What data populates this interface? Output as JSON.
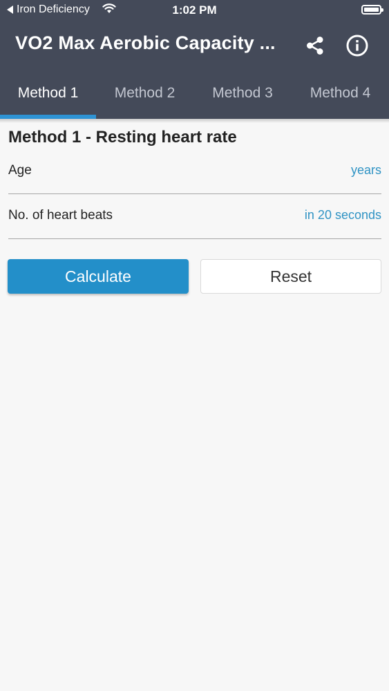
{
  "status_bar": {
    "back_label": "Iron Deficiency",
    "time": "1:02 PM"
  },
  "header": {
    "title": "VO2 Max Aerobic Capacity ..."
  },
  "tabs": [
    {
      "label": "Method 1"
    },
    {
      "label": "Method 2"
    },
    {
      "label": "Method 3"
    },
    {
      "label": "Method 4"
    }
  ],
  "form": {
    "section_title": "Method 1 - Resting heart rate",
    "fields": [
      {
        "label": "Age",
        "unit": "years"
      },
      {
        "label": "No. of heart beats",
        "unit": "in 20 seconds"
      }
    ]
  },
  "buttons": {
    "calculate": "Calculate",
    "reset": "Reset"
  },
  "colors": {
    "header": "#444a59",
    "accent": "#2e93d4",
    "unit_text": "#2f93c4",
    "calculate_button": "#238fc9"
  }
}
